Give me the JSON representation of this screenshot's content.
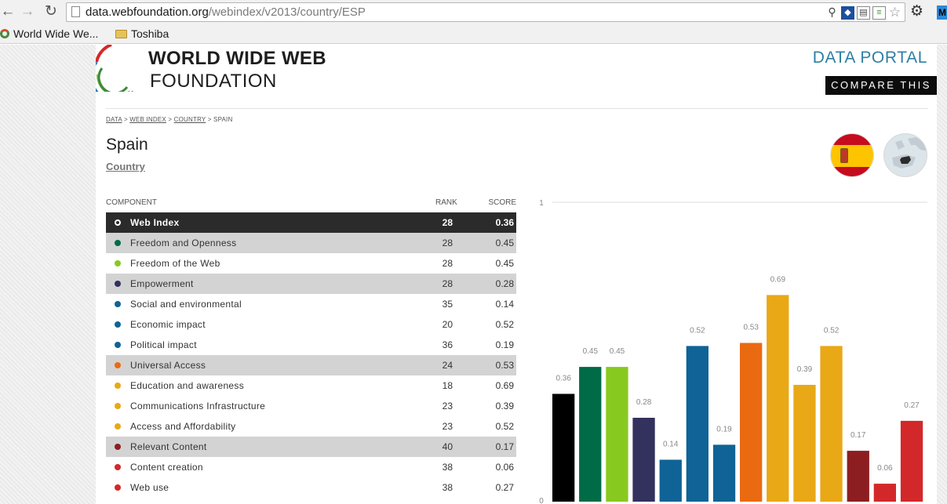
{
  "browser": {
    "url_host": "data.webfoundation.org",
    "url_path": "/webindex/v2013/country/ESP",
    "bookmarks": [
      {
        "label": "World Wide We...",
        "icon": "webfoundation-favicon"
      },
      {
        "label": "Toshiba",
        "icon": "folder-icon"
      }
    ]
  },
  "header": {
    "brand_line1": "WORLD WIDE WEB",
    "brand_line2": "FOUNDATION",
    "data_portal": "DATA PORTAL",
    "compare": "COMPARE THIS"
  },
  "breadcrumb": [
    {
      "label": "DATA",
      "link": true
    },
    {
      "label": "WEB INDEX",
      "link": true
    },
    {
      "label": "COUNTRY",
      "link": true
    },
    {
      "label": "SPAIN",
      "link": false
    }
  ],
  "page": {
    "title": "Spain",
    "subtitle": "Country"
  },
  "table": {
    "headers": {
      "component": "COMPONENT",
      "rank": "RANK",
      "score": "SCORE"
    },
    "rows": [
      {
        "name": "Web Index",
        "rank": "28",
        "score": "0.36",
        "color": "#000000",
        "style": "dark"
      },
      {
        "name": "Freedom and Openness",
        "rank": "28",
        "score": "0.45",
        "color": "#006b47",
        "style": "gray"
      },
      {
        "name": "Freedom of the Web",
        "rank": "28",
        "score": "0.45",
        "color": "#88c920",
        "style": "white"
      },
      {
        "name": "Empowerment",
        "rank": "28",
        "score": "0.28",
        "color": "#33315e",
        "style": "gray"
      },
      {
        "name": "Social and environmental",
        "rank": "35",
        "score": "0.14",
        "color": "#0f6396",
        "style": "white"
      },
      {
        "name": "Economic impact",
        "rank": "20",
        "score": "0.52",
        "color": "#0f6396",
        "style": "white"
      },
      {
        "name": "Political impact",
        "rank": "36",
        "score": "0.19",
        "color": "#0f6396",
        "style": "white"
      },
      {
        "name": "Universal Access",
        "rank": "24",
        "score": "0.53",
        "color": "#ea6a12",
        "style": "gray"
      },
      {
        "name": "Education and awareness",
        "rank": "18",
        "score": "0.69",
        "color": "#e9a816",
        "style": "white"
      },
      {
        "name": "Communications Infrastructure",
        "rank": "23",
        "score": "0.39",
        "color": "#e9a816",
        "style": "white"
      },
      {
        "name": "Access and Affordability",
        "rank": "23",
        "score": "0.52",
        "color": "#e9a816",
        "style": "white"
      },
      {
        "name": "Relevant Content",
        "rank": "40",
        "score": "0.17",
        "color": "#8c1e22",
        "style": "gray"
      },
      {
        "name": "Content creation",
        "rank": "38",
        "score": "0.06",
        "color": "#d3282a",
        "style": "white"
      },
      {
        "name": "Web use",
        "rank": "38",
        "score": "0.27",
        "color": "#d3282a",
        "style": "white"
      }
    ]
  },
  "chart_data": {
    "type": "bar",
    "ylim": [
      0,
      1
    ],
    "y_ticks": [
      "1",
      "0"
    ],
    "grid": true,
    "categories": [
      "Web Index",
      "Freedom and Openness",
      "Freedom of the Web",
      "Empowerment",
      "Social and environmental",
      "Economic impact",
      "Political impact",
      "Universal Access",
      "Education and awareness",
      "Communications Infrastructure",
      "Access and Affordability",
      "Relevant Content",
      "Content creation",
      "Web use"
    ],
    "values": [
      0.36,
      0.45,
      0.45,
      0.28,
      0.14,
      0.52,
      0.19,
      0.53,
      0.69,
      0.39,
      0.52,
      0.17,
      0.06,
      0.27
    ],
    "labels": [
      "0.36",
      "0.45",
      "0.45",
      "0.28",
      "0.14",
      "0.52",
      "0.19",
      "0.53",
      "0.69",
      "0.39",
      "0.52",
      "0.17",
      "0.06",
      "0.27"
    ],
    "colors": [
      "#000000",
      "#006b47",
      "#88c920",
      "#33315e",
      "#0f6396",
      "#0f6396",
      "#0f6396",
      "#ea6a12",
      "#e9a816",
      "#e9a816",
      "#e9a816",
      "#8c1e22",
      "#d3282a",
      "#d3282a"
    ]
  }
}
